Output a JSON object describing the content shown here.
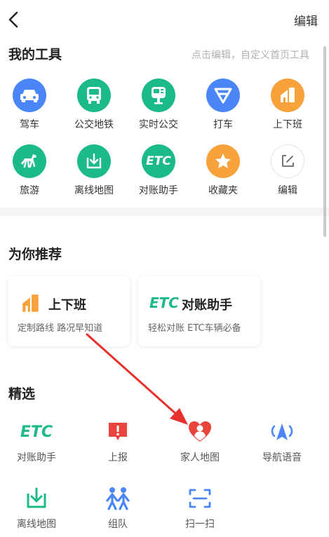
{
  "header": {
    "edit_label": "编辑"
  },
  "my_tools": {
    "title": "我的工具",
    "hint": "点击编辑，自定义首页工具",
    "items": [
      {
        "label": "驾车",
        "icon": "car-icon",
        "color": "#4a86f5"
      },
      {
        "label": "公交地铁",
        "icon": "bus-icon",
        "color": "#1cb98a"
      },
      {
        "label": "实时公交",
        "icon": "realtime-bus-icon",
        "color": "#1cb98a"
      },
      {
        "label": "打车",
        "icon": "taxi-icon",
        "color": "#4a86f5"
      },
      {
        "label": "上下班",
        "icon": "commute-icon",
        "color": "#f7a23a"
      },
      {
        "label": "旅游",
        "icon": "horse-icon",
        "color": "#1cb98a"
      },
      {
        "label": "离线地图",
        "icon": "download-icon",
        "color": "#1cb98a"
      },
      {
        "label": "对账助手",
        "icon": "etc-icon",
        "color": "#1cb98a",
        "icon_text": "ETC"
      },
      {
        "label": "收藏夹",
        "icon": "star-icon",
        "color": "#f7a23a"
      },
      {
        "label": "编辑",
        "icon": "edit-icon",
        "color": "#ffffff"
      }
    ]
  },
  "recommend": {
    "title": "为你推荐",
    "cards": [
      {
        "title": "上下班",
        "subtitle": "定制路线 路况早知道",
        "icon": "commute-icon"
      },
      {
        "title": "对账助手",
        "subtitle": "轻松对账 ETC车辆必备",
        "icon": "etc-icon",
        "icon_text": "ETC"
      }
    ]
  },
  "featured": {
    "title": "精选",
    "items": [
      {
        "label": "对账助手",
        "icon": "etc-icon",
        "icon_text": "ETC",
        "color": "#1cb98a"
      },
      {
        "label": "上报",
        "icon": "report-icon",
        "color": "#e9453c"
      },
      {
        "label": "家人地图",
        "icon": "family-map-icon",
        "color": "#e9453c"
      },
      {
        "label": "导航语音",
        "icon": "nav-voice-icon",
        "color": "#4a86f5"
      },
      {
        "label": "离线地图",
        "icon": "download-icon",
        "color": "#1cb98a"
      },
      {
        "label": "组队",
        "icon": "team-icon",
        "color": "#4a86f5"
      },
      {
        "label": "扫一扫",
        "icon": "scan-icon",
        "color": "#4a86f5"
      }
    ]
  },
  "annotation": {
    "color": "#e8302c"
  }
}
